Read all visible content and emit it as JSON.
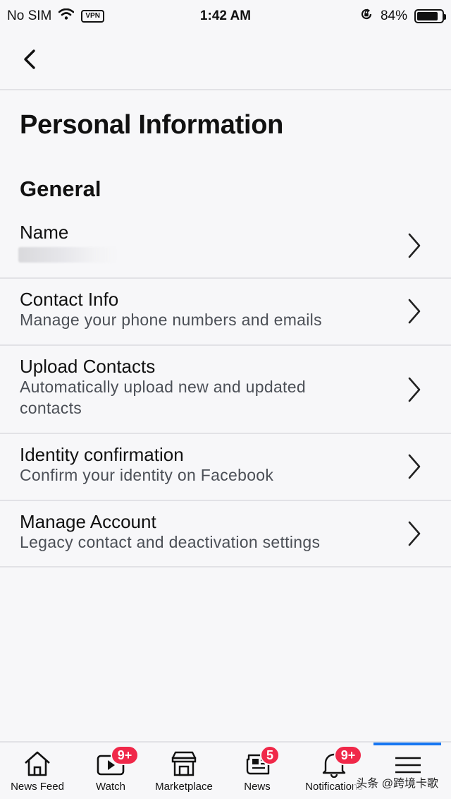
{
  "status_bar": {
    "carrier": "No SIM",
    "vpn": "VPN",
    "time": "1:42 AM",
    "battery": "84%",
    "battery_level": 0.84
  },
  "header": {
    "back_icon": "chevron-left-icon"
  },
  "page": {
    "title": "Personal Information",
    "section": "General"
  },
  "rows": [
    {
      "title": "Name",
      "subtitle": ""
    },
    {
      "title": "Contact Info",
      "subtitle": "Manage your phone numbers and emails"
    },
    {
      "title": "Upload Contacts",
      "subtitle": "Automatically upload new and updated contacts"
    },
    {
      "title": "Identity confirmation",
      "subtitle": "Confirm your identity on Facebook"
    },
    {
      "title": "Manage Account",
      "subtitle": "Legacy contact and deactivation settings"
    }
  ],
  "tab_bar": {
    "tabs": [
      {
        "label": "News Feed",
        "icon": "home-icon",
        "badge": ""
      },
      {
        "label": "Watch",
        "icon": "video-icon",
        "badge": "9+"
      },
      {
        "label": "Marketplace",
        "icon": "shop-icon",
        "badge": ""
      },
      {
        "label": "News",
        "icon": "newspaper-icon",
        "badge": "5"
      },
      {
        "label": "Notifications",
        "icon": "bell-icon",
        "badge": "9+"
      },
      {
        "label": "",
        "icon": "menu-icon",
        "badge": ""
      }
    ],
    "active_color": "#1877f2",
    "badge_color": "#f02849"
  },
  "watermark": "头条 @跨境卡歌"
}
